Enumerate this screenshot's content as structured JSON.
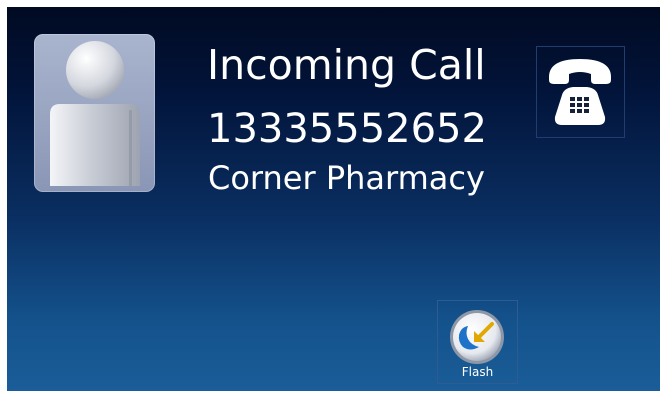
{
  "call": {
    "status": "Incoming Call",
    "number": "13335552652",
    "caller_name": "Corner Pharmacy"
  },
  "buttons": {
    "answer": {
      "icon": "phone-answer-icon"
    },
    "flash": {
      "label": "Flash",
      "icon": "flash-arrow-icon"
    }
  },
  "avatar": {
    "icon": "contact-silhouette-icon"
  },
  "colors": {
    "background_top": "#010a22",
    "background_bottom": "#1a5d98",
    "text": "#ffffff"
  }
}
